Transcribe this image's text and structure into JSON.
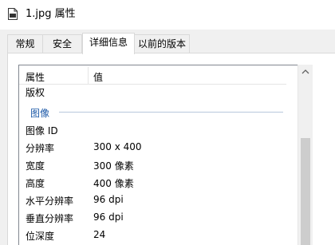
{
  "window": {
    "title": "1.jpg 属性"
  },
  "tabs": [
    {
      "label": "常规"
    },
    {
      "label": "安全"
    },
    {
      "label": "详细信息"
    },
    {
      "label": "以前的版本"
    }
  ],
  "details": {
    "headers": {
      "property": "属性",
      "value": "值"
    },
    "rows_top": [
      {
        "key": "版权",
        "value": ""
      }
    ],
    "group_image": {
      "label": "图像"
    },
    "rows": [
      {
        "key": "图像 ID",
        "value": ""
      },
      {
        "key": "分辨率",
        "value": "300 x 400"
      },
      {
        "key": "宽度",
        "value": "300 像素"
      },
      {
        "key": "高度",
        "value": "400 像素"
      },
      {
        "key": "水平分辨率",
        "value": "96 dpi"
      },
      {
        "key": "垂直分辨率",
        "value": "96 dpi"
      },
      {
        "key": "位深度",
        "value": "24"
      }
    ]
  },
  "icons": {
    "file": "file-icon",
    "scroll_up": "chevron-up-icon"
  },
  "colors": {
    "group_label": "#1e5aa8",
    "scroll_thumb": "#cdcdcd",
    "dialog_bg": "#f0f0f0"
  }
}
